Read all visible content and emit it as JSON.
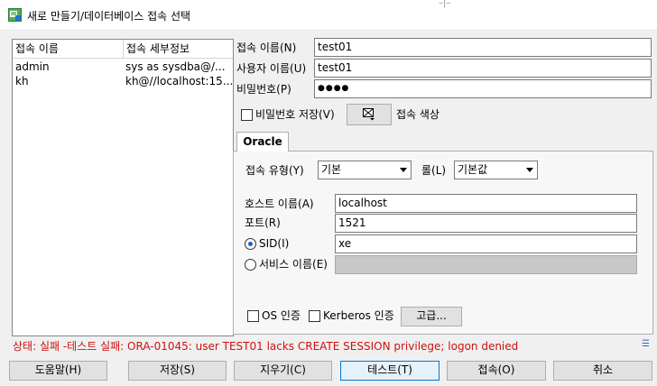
{
  "window": {
    "title": "새로 만들기/데이터베이스 접속 선택",
    "behind_fragment": "–|–"
  },
  "connection_list": {
    "headers": [
      "접속 이름",
      "접속 세부정보"
    ],
    "rows": [
      {
        "name": "admin",
        "details": "sys as sysdba@/..."
      },
      {
        "name": "kh",
        "details": "kh@//localhost:15..."
      }
    ]
  },
  "form": {
    "conn_name_label": "접속 이름(N)",
    "conn_name_value": "test01",
    "user_label": "사용자 이름(U)",
    "user_value": "test01",
    "password_label": "비밀번호(P)",
    "password_value": "●●●●",
    "save_password_label": "비밀번호 저장(V)",
    "color_label": "접속 색상"
  },
  "tab": {
    "label": "Oracle"
  },
  "oracle": {
    "conn_type_label": "접속 유형(Y)",
    "conn_type_value": "기본",
    "role_label": "롤(L)",
    "role_value": "기본값",
    "host_label": "호스트 이름(A)",
    "host_value": "localhost",
    "port_label": "포트(R)",
    "port_value": "1521",
    "sid_label": "SID(I)",
    "sid_value": "xe",
    "service_label": "서비스 이름(E)",
    "service_value": "",
    "os_auth_label": "OS 인증",
    "kerberos_label": "Kerberos 인증",
    "advanced_label": "고급..."
  },
  "status": {
    "text": "상태: 실패 -테스트 실패: ORA-01045: user TEST01 lacks CREATE SESSION privilege; logon denied",
    "color": "#d01010"
  },
  "buttons": {
    "help": "도움말(H)",
    "save": "저장(S)",
    "clear": "지우기(C)",
    "test": "테스트(T)",
    "connect": "접속(O)",
    "cancel": "취소"
  }
}
